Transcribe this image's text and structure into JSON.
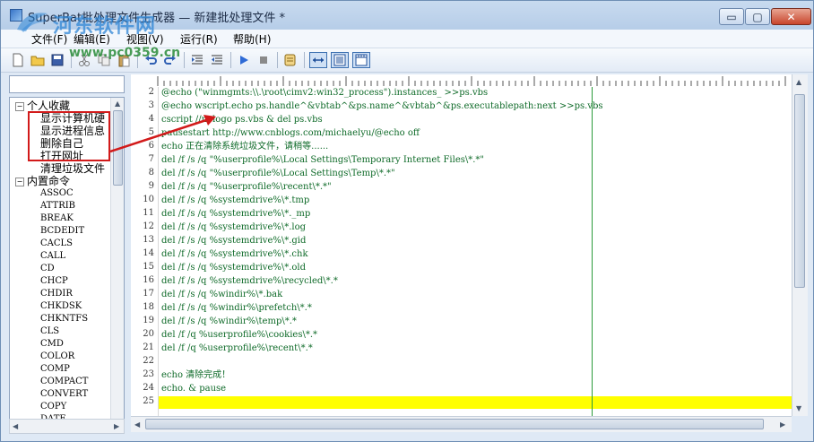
{
  "window": {
    "title": "SuperBat批处理文件生成器 — 新建批处理文件 *"
  },
  "watermark": {
    "site": "河东软件网",
    "url": "www.pc0359.cn"
  },
  "controls": {
    "minimize": "▭",
    "maximize": "▢",
    "close": "✕"
  },
  "menu": [
    "文件(F)",
    "编辑(E)",
    "视图(V)",
    "运行(R)",
    "帮助(H)"
  ],
  "toolbar_icons": [
    "new-file-icon",
    "open-folder-icon",
    "save-icon",
    "cut-icon",
    "copy-icon",
    "paste-icon",
    "undo-icon",
    "redo-icon",
    "indent-icon",
    "outdent-icon",
    "run-icon",
    "stop-icon",
    "script-icon",
    "wrap-icon",
    "page-icon",
    "ruler-icon"
  ],
  "tree": {
    "group1": {
      "expander": "−",
      "label": "个人收藏"
    },
    "favorites": [
      "显示计算机硬",
      "显示进程信息",
      "删除自己",
      "打开网址",
      "清理垃圾文件"
    ],
    "group2": {
      "expander": "−",
      "label": "内置命令"
    },
    "commands": [
      "ASSOC",
      "ATTRIB",
      "BREAK",
      "BCDEDIT",
      "CACLS",
      "CALL",
      "CD",
      "CHCP",
      "CHDIR",
      "CHKDSK",
      "CHKNTFS",
      "CLS",
      "CMD",
      "COLOR",
      "COMP",
      "COMPACT",
      "CONVERT",
      "COPY",
      "DATE"
    ]
  },
  "editor": {
    "line_numbers": [
      "2",
      "3",
      "4",
      "5",
      "6",
      "7",
      "8",
      "9",
      "10",
      "11",
      "12",
      "13",
      "14",
      "15",
      "16",
      "17",
      "18",
      "19",
      "20",
      "21",
      "22",
      "23",
      "24",
      "25"
    ],
    "lines": [
      "@echo (\"winmgmts:\\\\.\\root\\cimv2:win32_process\").instances_ >>ps.vbs",
      "@echo wscript.echo ps.handle^&vbtab^&ps.name^&vbtab^&ps.executablepath:next >>ps.vbs",
      "cscript //nologo ps.vbs & del ps.vbs",
      "pausestart http://www.cnblogs.com/michaelyu/@echo off",
      "echo 正在清除系统垃圾文件，请稍等......",
      "del /f /s /q \"%userprofile%\\Local Settings\\Temporary Internet Files\\*.*\"",
      "del /f /s /q \"%userprofile%\\Local Settings\\Temp\\*.*\"",
      "del /f /s /q \"%userprofile%\\recent\\*.*\"",
      "del /f /s /q %systemdrive%\\*.tmp",
      "del /f /s /q %systemdrive%\\*._mp",
      "del /f /s /q %systemdrive%\\*.log",
      "del /f /s /q %systemdrive%\\*.gid",
      "del /f /s /q %systemdrive%\\*.chk",
      "del /f /s /q %systemdrive%\\*.old",
      "del /f /s /q %systemdrive%\\recycled\\*.*",
      "del /f /s /q %windir%\\*.bak",
      "del /f /s /q %windir%\\prefetch\\*.*",
      "del /f /s /q %windir%\\temp\\*.*",
      "del /f /q %userprofile%\\cookies\\*.*",
      "del /f /q %userprofile%\\recent\\*.*",
      "",
      "echo 清除完成！",
      "echo. & pause",
      ""
    ]
  },
  "colors": {
    "code_text": "#0e6a28",
    "current_line": "#ffff00",
    "highlight_box": "#d21a1a",
    "margin_line": "#2a9a3a"
  }
}
